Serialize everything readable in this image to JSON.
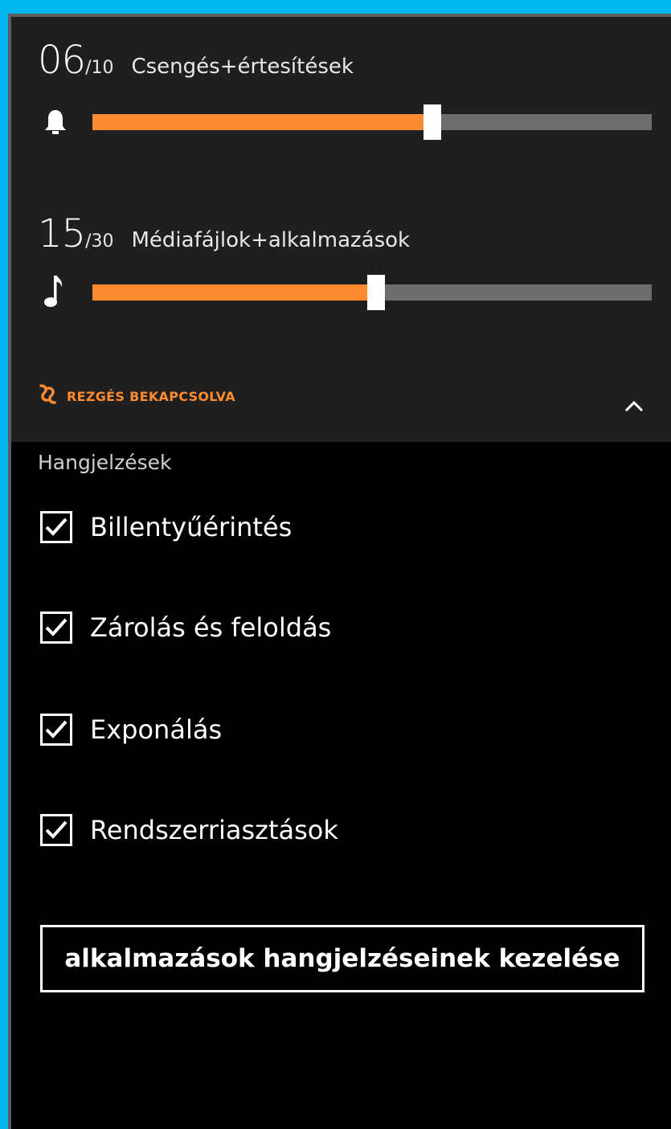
{
  "ringer": {
    "value": "06",
    "max": "/10",
    "label": "Csengés+értesítések",
    "level_fraction": 0.6,
    "icon": "bell-icon"
  },
  "media": {
    "value": "15",
    "max": "/30",
    "label": "Médiafájlok+alkalmazások",
    "level_fraction": 0.5,
    "icon": "music-note-icon"
  },
  "vibration": {
    "label": "REZGÉS BEKAPCSOLVA",
    "icon": "vibrate-icon"
  },
  "colors": {
    "accent": "#ff8b31",
    "track": "#6d6d6d",
    "panel": "#1f1f1f",
    "background": "#000000",
    "frame": "#00b8ef"
  },
  "sounds": {
    "title": "Hangjelzések",
    "items": [
      {
        "label": "Billentyűérintés",
        "checked": true
      },
      {
        "label": "Zárolás és feloldás",
        "checked": true
      },
      {
        "label": "Exponálás",
        "checked": true
      },
      {
        "label": "Rendszerriasztások",
        "checked": true
      }
    ]
  },
  "manage_button": {
    "label": "alkalmazások hangjelzéseinek kezelése"
  }
}
